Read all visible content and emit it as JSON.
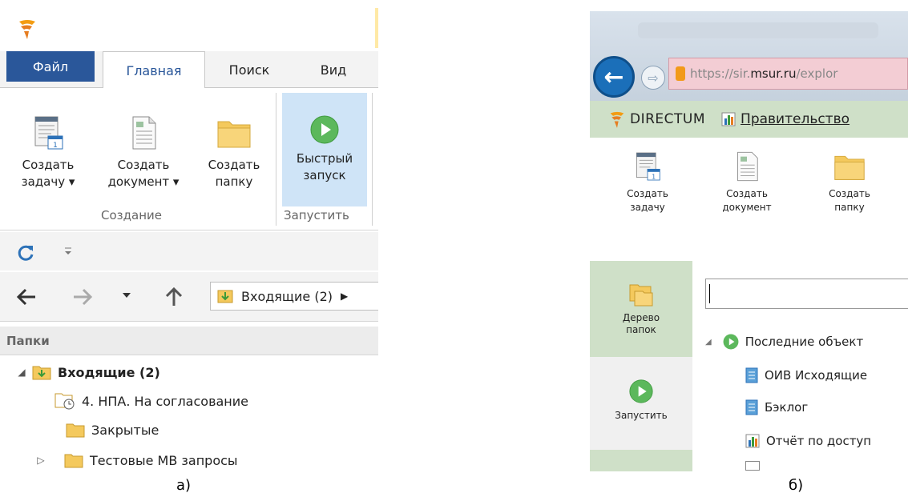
{
  "left_panel": {
    "tabs": {
      "file": "Файл",
      "main": "Главная",
      "search": "Поиск",
      "view": "Вид"
    },
    "ribbon": {
      "create_task": {
        "line1": "Создать",
        "line2": "задачу ▾"
      },
      "create_document": {
        "line1": "Создать",
        "line2": "документ ▾"
      },
      "create_folder": {
        "line1": "Создать",
        "line2": "папку"
      },
      "quick_launch": {
        "line1": "Быстрый",
        "line2": "запуск"
      },
      "group_create": "Создание",
      "group_run": "Запустить",
      "calendar_day": "1"
    },
    "address": {
      "text": "Входящие (2)"
    },
    "folders_header": "Папки",
    "tree": [
      {
        "label": "Входящие (2)"
      },
      {
        "label": "4. НПА. На согласование"
      },
      {
        "label": "Закрытые"
      },
      {
        "label": "Тестовые МВ запросы"
      }
    ]
  },
  "right_panel": {
    "url": {
      "prefix": "https://sir.",
      "domain": "msur.ru",
      "suffix": "/explor"
    },
    "brand": {
      "name": "DIRECTUM",
      "gov": "Правительство"
    },
    "ribbon": {
      "create_task": {
        "line1": "Создать",
        "line2": "задачу"
      },
      "create_document": {
        "line1": "Создать",
        "line2": "документ"
      },
      "create_folder": {
        "line1": "Создать",
        "line2": "папку"
      },
      "calendar_day": "1"
    },
    "side": {
      "tree": {
        "line1": "Дерево",
        "line2": "папок"
      },
      "run": "Запустить"
    },
    "tree": [
      {
        "label": "Последние объект"
      },
      {
        "label": "ОИВ Исходящие"
      },
      {
        "label": "Бэклог"
      },
      {
        "label": "Отчёт по доступ"
      }
    ]
  },
  "captions": {
    "left": "а)",
    "right": "б)"
  },
  "colors": {
    "file_tab": "#2a579a",
    "quick_highlight": "#cfe4f7",
    "brand_bar": "#cfe0c8",
    "play_green": "#5cb85c",
    "folder_yellow": "#f4c95d"
  }
}
